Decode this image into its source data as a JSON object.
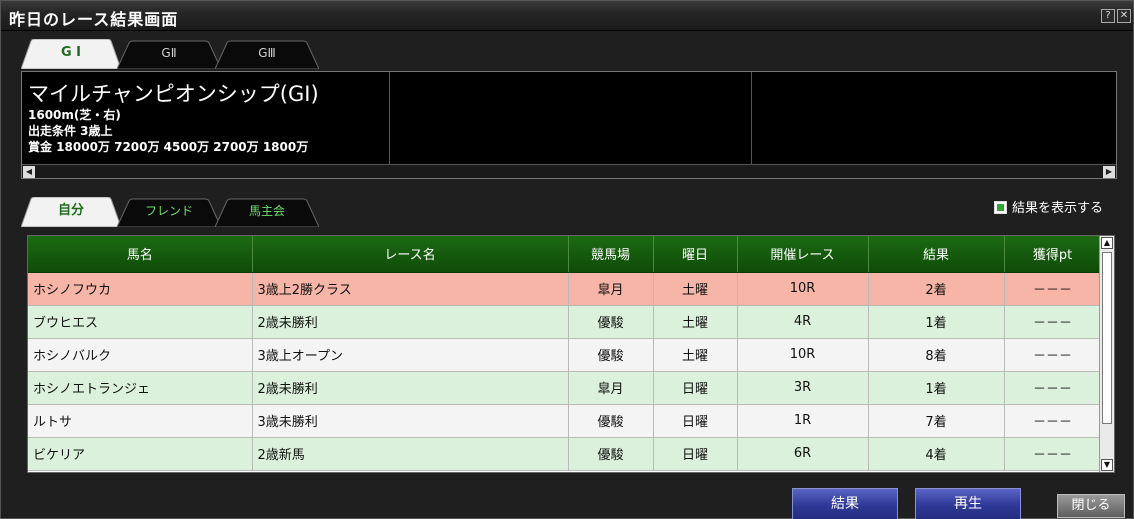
{
  "window": {
    "title": "昨日のレース結果画面",
    "help_glyph": "?",
    "close_glyph": "✕"
  },
  "grade_tabs": [
    {
      "label": "G I",
      "active": true
    },
    {
      "label": "GⅡ",
      "active": false
    },
    {
      "label": "GⅢ",
      "active": false
    }
  ],
  "race": {
    "name": "マイルチャンピオンシップ(GⅠ)",
    "distance": "1600m(芝・右)",
    "condition": "出走条件 3歳上",
    "prize": "賞金 18000万 7200万 4500万 2700万 1800万"
  },
  "user_tabs": [
    {
      "label": "自分",
      "active": true
    },
    {
      "label": "フレンド",
      "active": false
    },
    {
      "label": "馬主会",
      "active": false
    }
  ],
  "show_result": {
    "label": "結果を表示する",
    "checked": true
  },
  "table": {
    "headers": [
      "馬名",
      "レース名",
      "競馬場",
      "曜日",
      "開催レース",
      "結果",
      "獲得pt"
    ],
    "rows": [
      {
        "horse": "ホシノフウカ",
        "race": "3歳上2勝クラス",
        "track": "皐月",
        "day": "土曜",
        "race_no": "10R",
        "result": "2着",
        "pt": "－－－"
      },
      {
        "horse": "ブウヒエス",
        "race": "2歳未勝利",
        "track": "優駿",
        "day": "土曜",
        "race_no": "4R",
        "result": "1着",
        "pt": "－－－"
      },
      {
        "horse": "ホシノバルク",
        "race": "3歳上オープン",
        "track": "優駿",
        "day": "土曜",
        "race_no": "10R",
        "result": "8着",
        "pt": "－－－"
      },
      {
        "horse": "ホシノエトランジェ",
        "race": "2歳未勝利",
        "track": "皐月",
        "day": "日曜",
        "race_no": "3R",
        "result": "1着",
        "pt": "－－－"
      },
      {
        "horse": "ルトサ",
        "race": "3歳未勝利",
        "track": "優駿",
        "day": "日曜",
        "race_no": "1R",
        "result": "7着",
        "pt": "－－－"
      },
      {
        "horse": "ビケリア",
        "race": "2歳新馬",
        "track": "優駿",
        "day": "日曜",
        "race_no": "6R",
        "result": "4着",
        "pt": "－－－"
      }
    ]
  },
  "buttons": {
    "result": "結果",
    "replay": "再生",
    "close": "閉じる"
  },
  "colors": {
    "header_green": "#1c6a12",
    "row_pink": "#f6b5a6",
    "row_green": "#dcf1dc",
    "row_white": "#f4f4f4",
    "button_blue": "#2e3896"
  }
}
